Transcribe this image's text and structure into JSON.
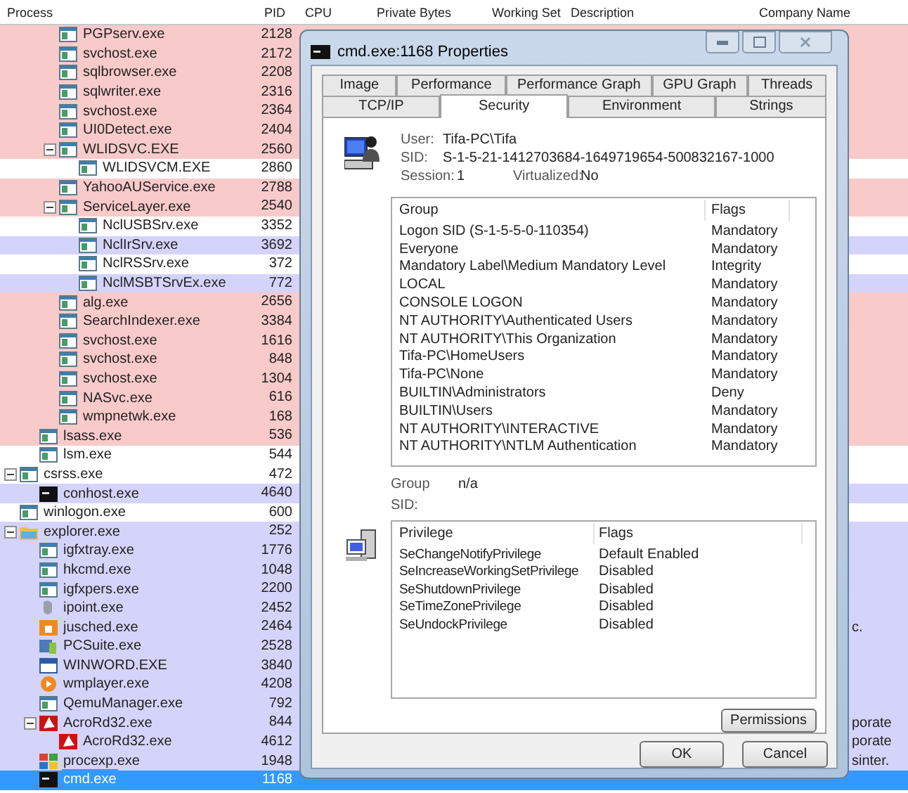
{
  "columns": [
    "Process",
    "PID",
    "CPU",
    "Private Bytes",
    "Working Set",
    "Description",
    "Company Name"
  ],
  "process_tree": [
    {
      "children": [
        {
          "children": [
            {
              "name": "PGPserv.exe",
              "pid": "2128",
              "kind": "app",
              "color": "#f9caca",
              "selected": false
            },
            {
              "name": "svchost.exe",
              "pid": "2172",
              "kind": "app",
              "color": "#f9caca",
              "selected": false
            },
            {
              "name": "sqlbrowser.exe",
              "pid": "2208",
              "kind": "app",
              "color": "#f9caca",
              "selected": false
            },
            {
              "name": "sqlwriter.exe",
              "pid": "2316",
              "kind": "app",
              "color": "#f9caca",
              "selected": false
            },
            {
              "name": "svchost.exe",
              "pid": "2364",
              "kind": "app",
              "color": "#f9caca",
              "selected": false
            },
            {
              "name": "UI0Detect.exe",
              "pid": "2404",
              "kind": "app",
              "color": "#f9caca",
              "selected": false
            },
            {
              "name": "WLIDSVC.EXE",
              "pid": "2560",
              "kind": "app",
              "color": "#f9caca",
              "selected": false,
              "expanded": true,
              "children": [
                {
                  "name": "WLIDSVCM.EXE",
                  "pid": "2860",
                  "kind": "app",
                  "color": "#ffffff",
                  "selected": false
                }
              ]
            },
            {
              "name": "YahooAUService.exe",
              "pid": "2788",
              "kind": "app",
              "color": "#f9caca",
              "selected": false
            },
            {
              "name": "ServiceLayer.exe",
              "pid": "2540",
              "kind": "app",
              "color": "#f9caca",
              "selected": false,
              "expanded": true,
              "children": [
                {
                  "name": "NclUSBSrv.exe",
                  "pid": "3352",
                  "kind": "app",
                  "color": "#ffffff",
                  "selected": false
                },
                {
                  "name": "NclIrSrv.exe",
                  "pid": "3692",
                  "kind": "app",
                  "color": "#d4d4fa",
                  "selected": false
                },
                {
                  "name": "NclRSSrv.exe",
                  "pid": "372",
                  "kind": "app",
                  "color": "#ffffff",
                  "selected": false
                },
                {
                  "name": "NclMSBTSrvEx.exe",
                  "pid": "772",
                  "kind": "app",
                  "color": "#d4d4fa",
                  "selected": false
                }
              ]
            },
            {
              "name": "alg.exe",
              "pid": "2656",
              "kind": "app",
              "color": "#f9caca",
              "selected": false
            },
            {
              "name": "SearchIndexer.exe",
              "pid": "3384",
              "kind": "app",
              "color": "#f9caca",
              "selected": false
            },
            {
              "name": "svchost.exe",
              "pid": "1616",
              "kind": "app",
              "color": "#f9caca",
              "selected": false
            },
            {
              "name": "svchost.exe",
              "pid": "848",
              "kind": "app",
              "color": "#f9caca",
              "selected": false
            },
            {
              "name": "svchost.exe",
              "pid": "1304",
              "kind": "app",
              "color": "#f9caca",
              "selected": false
            },
            {
              "name": "NASvc.exe",
              "pid": "616",
              "kind": "app",
              "color": "#f9caca",
              "selected": false
            },
            {
              "name": "wmpnetwk.exe",
              "pid": "168",
              "kind": "app",
              "color": "#f9caca",
              "selected": false
            }
          ]
        },
        {
          "name": "lsass.exe",
          "pid": "536",
          "kind": "app",
          "color": "#f9caca",
          "selected": false
        },
        {
          "name": "lsm.exe",
          "pid": "544",
          "kind": "app",
          "color": "#ffffff",
          "selected": false
        }
      ]
    },
    {
      "name": "csrss.exe",
      "pid": "472",
      "kind": "app",
      "color": "#ffffff",
      "selected": false,
      "expanded": true,
      "children": [
        {
          "name": "conhost.exe",
          "pid": "4640",
          "kind": "console",
          "color": "#d4d4fa",
          "selected": false
        }
      ]
    },
    {
      "name": "winlogon.exe",
      "pid": "600",
      "kind": "app",
      "color": "#ffffff",
      "selected": false
    },
    {
      "name": "explorer.exe",
      "pid": "252",
      "kind": "folder",
      "color": "#d4d4fa",
      "selected": false,
      "expanded": true,
      "children": [
        {
          "name": "igfxtray.exe",
          "pid": "1776",
          "kind": "app",
          "color": "#d4d4fa",
          "selected": false
        },
        {
          "name": "hkcmd.exe",
          "pid": "1048",
          "kind": "app",
          "color": "#d4d4fa",
          "selected": false
        },
        {
          "name": "igfxpers.exe",
          "pid": "2200",
          "kind": "app",
          "color": "#d4d4fa",
          "selected": false
        },
        {
          "name": "ipoint.exe",
          "pid": "2452",
          "kind": "mouse",
          "color": "#d4d4fa",
          "selected": false
        },
        {
          "name": "jusched.exe",
          "pid": "2464",
          "kind": "java",
          "color": "#d4d4fa",
          "selected": false,
          "company": "c."
        },
        {
          "name": "PCSuite.exe",
          "pid": "2528",
          "kind": "phone",
          "color": "#d4d4fa",
          "selected": false
        },
        {
          "name": "WINWORD.EXE",
          "pid": "3840",
          "kind": "word",
          "color": "#d4d4fa",
          "selected": false
        },
        {
          "name": "wmplayer.exe",
          "pid": "4208",
          "kind": "player",
          "color": "#d4d4fa",
          "selected": false
        },
        {
          "name": "QemuManager.exe",
          "pid": "792",
          "kind": "app",
          "color": "#d4d4fa",
          "selected": false
        },
        {
          "name": "AcroRd32.exe",
          "pid": "844",
          "kind": "pdf",
          "color": "#d4d4fa",
          "selected": false,
          "company": "porate",
          "expanded": true,
          "children": [
            {
              "name": "AcroRd32.exe",
              "pid": "4612",
              "kind": "pdf",
              "color": "#d4d4fa",
              "selected": false,
              "company": "porate"
            }
          ]
        },
        {
          "name": "procexp.exe",
          "pid": "1948",
          "kind": "procexp",
          "color": "#d4d4fa",
          "selected": false,
          "company": "sinter."
        },
        {
          "name": "cmd.exe",
          "pid": "1168",
          "kind": "console",
          "selected": true
        }
      ]
    }
  ],
  "dialog": {
    "title": "cmd.exe:1168 Properties",
    "tab_rows": [
      [
        {
          "label": "Image",
          "selected": false
        },
        {
          "label": "Performance",
          "selected": false
        },
        {
          "label": "Performance Graph",
          "selected": false
        },
        {
          "label": "GPU Graph",
          "selected": false
        },
        {
          "label": "Threads",
          "selected": false
        }
      ],
      [
        {
          "label": "TCP/IP",
          "selected": false
        },
        {
          "label": "Security",
          "selected": true
        },
        {
          "label": "Environment",
          "selected": false
        },
        {
          "label": "Strings",
          "selected": false
        }
      ]
    ],
    "user": {
      "label": "User:",
      "value": "Tifa-PC\\Tifa"
    },
    "sid": {
      "label": "SID:",
      "value": "S-1-5-21-1412703684-1649719654-500832167-1000"
    },
    "session": {
      "label": "Session:",
      "value": "1"
    },
    "virtualized": {
      "label": "Virtualized:",
      "value": "No"
    },
    "groups": {
      "columns": [
        "Group",
        "Flags"
      ],
      "rows": [
        [
          "Logon SID (S-1-5-5-0-110354)",
          "Mandatory"
        ],
        [
          "Everyone",
          "Mandatory"
        ],
        [
          "Mandatory Label\\Medium Mandatory Level",
          "Integrity"
        ],
        [
          "LOCAL",
          "Mandatory"
        ],
        [
          "CONSOLE LOGON",
          "Mandatory"
        ],
        [
          "NT AUTHORITY\\Authenticated Users",
          "Mandatory"
        ],
        [
          "NT AUTHORITY\\This Organization",
          "Mandatory"
        ],
        [
          "Tifa-PC\\HomeUsers",
          "Mandatory"
        ],
        [
          "Tifa-PC\\None",
          "Mandatory"
        ],
        [
          "BUILTIN\\Administrators",
          "Deny"
        ],
        [
          "BUILTIN\\Users",
          "Mandatory"
        ],
        [
          "NT AUTHORITY\\INTERACTIVE",
          "Mandatory"
        ],
        [
          "NT AUTHORITY\\NTLM Authentication",
          "Mandatory"
        ]
      ]
    },
    "group_sid": {
      "label": "Group SID:",
      "value": "n/a"
    },
    "privileges": {
      "columns": [
        "Privilege",
        "Flags"
      ],
      "rows": [
        [
          "SeChangeNotifyPrivilege",
          "Default Enabled"
        ],
        [
          "SeIncreaseWorkingSetPrivilege",
          "Disabled"
        ],
        [
          "SeShutdownPrivilege",
          "Disabled"
        ],
        [
          "SeTimeZonePrivilege",
          "Disabled"
        ],
        [
          "SeUndockPrivilege",
          "Disabled"
        ]
      ]
    },
    "permissions_button": "Permissions",
    "ok_button": "OK",
    "cancel_button": "Cancel"
  }
}
